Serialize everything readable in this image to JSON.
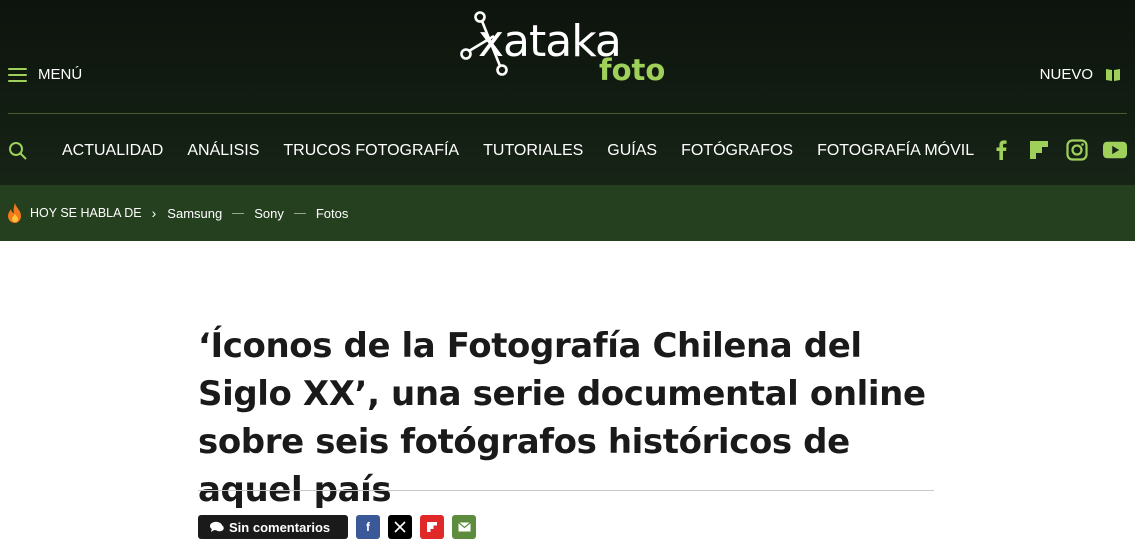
{
  "header": {
    "menu_label": "MENÚ",
    "logo_main": "xataka",
    "logo_sub": "foto",
    "new_label": "NUEVO"
  },
  "nav": {
    "items": [
      "ACTUALIDAD",
      "ANÁLISIS",
      "TRUCOS FOTOGRAFÍA",
      "TUTORIALES",
      "GUÍAS",
      "FOTÓGRAFOS",
      "FOTOGRAFÍA MÓVIL"
    ]
  },
  "social": [
    "facebook-icon",
    "flipboard-icon",
    "instagram-icon",
    "youtube-icon"
  ],
  "trending": {
    "label": "HOY SE HABLA DE",
    "tags": [
      "Samsung",
      "Sony",
      "Fotos"
    ]
  },
  "article": {
    "title": "‘Íconos de la Fotografía Chilena del Siglo XX’, una serie documental online sobre seis fotógrafos históricos de aquel país",
    "comments_label": "Sin comentarios"
  },
  "colors": {
    "header_bg": "#0d130d",
    "accent": "#9fd05a",
    "trending_bg": "#24401f",
    "facebook": "#3b5998",
    "x": "#000000",
    "flipboard": "#e12828",
    "email": "#5e8c3f"
  }
}
